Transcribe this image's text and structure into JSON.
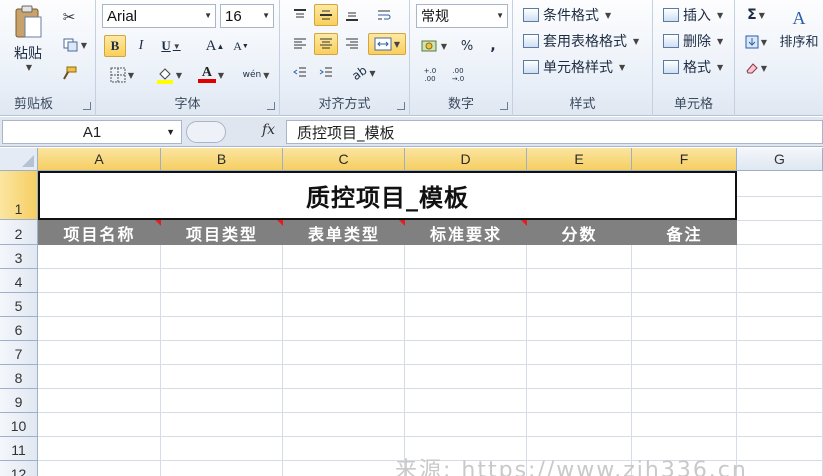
{
  "ribbon": {
    "clipboard": {
      "paste_label": "粘贴",
      "group_label": "剪贴板"
    },
    "font": {
      "font_name": "Arial",
      "font_size": "16",
      "bold": "B",
      "italic": "I",
      "underline": "U",
      "grow": "A",
      "shrink": "A",
      "phonetic": "wén",
      "group_label": "字体"
    },
    "alignment": {
      "group_label": "对齐方式"
    },
    "number": {
      "format": "常规",
      "percent": "%",
      "comma": ",",
      "inc_decimal": "+.0 .00",
      "dec_decimal": ".00 →.0",
      "group_label": "数字"
    },
    "styles": {
      "conditional": "条件格式",
      "table_format": "套用表格格式",
      "cell_styles": "单元格样式",
      "group_label": "样式"
    },
    "cells": {
      "insert": "插入",
      "delete": "删除",
      "format": "格式",
      "group_label": "单元格"
    },
    "editing": {
      "sum": "Σ",
      "sort_filter": "排序和"
    }
  },
  "formula_bar": {
    "name_box": "A1",
    "fx": "fx",
    "content": "质控项目_模板"
  },
  "sheet": {
    "columns": [
      "A",
      "B",
      "C",
      "D",
      "E",
      "F",
      "G"
    ],
    "rows": [
      "1",
      "2",
      "3",
      "4",
      "5",
      "6",
      "7",
      "8",
      "9",
      "10",
      "11",
      "12"
    ],
    "title": "质控项目_模板",
    "headers": [
      "项目名称",
      "项目类型",
      "表单类型",
      "标准要求",
      "分数",
      "备注"
    ]
  },
  "watermark": "来源: https://www.zjh336.cn",
  "colors": {
    "header_fill": "#808080",
    "header_text": "#ffffff",
    "selection": "#f6cf63",
    "comment_marker": "#e02020"
  }
}
